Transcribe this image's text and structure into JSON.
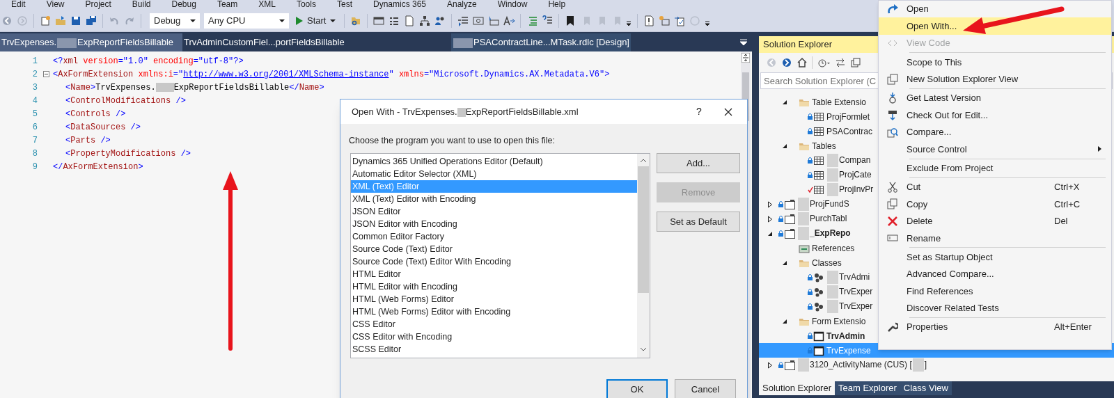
{
  "menu_bar": [
    "Edit",
    "View",
    "Project",
    "Build",
    "Debug",
    "Team",
    "XML",
    "Tools",
    "Test",
    "Dynamics 365",
    "Analyze",
    "Window",
    "Help"
  ],
  "toolbar": {
    "configuration": "Debug",
    "platform": "Any CPU",
    "start": "Start"
  },
  "doc_tabs": [
    {
      "parts": [
        {
          "kind": "text",
          "text": "TrvExpenses."
        },
        {
          "kind": "redaction"
        },
        {
          "kind": "text",
          "text": "ExpReportFieldsBillable"
        }
      ],
      "selected": true
    },
    {
      "parts": [
        {
          "kind": "text",
          "text": "TrvAdminCustomFiel...portFieldsBillable"
        }
      ],
      "selected": false
    },
    {
      "parts": [
        {
          "kind": "redaction"
        },
        {
          "kind": "text",
          "text": "PSAContractLine...MTask.rdlc [Design]"
        }
      ],
      "selected": false
    }
  ],
  "code": [
    {
      "number": "1",
      "tokens": [
        {
          "kind": "delimiter",
          "text": "<?"
        },
        {
          "kind": "element",
          "text": "xml"
        },
        {
          "kind": "attribute",
          "text": " version"
        },
        {
          "kind": "delimiter",
          "text": "=\"1.0\""
        },
        {
          "kind": "attribute",
          "text": " encoding"
        },
        {
          "kind": "delimiter",
          "text": "=\"utf-8\"?>"
        }
      ]
    },
    {
      "number": "2",
      "expanded": true,
      "tokens": [
        {
          "kind": "delimiter",
          "text": "<"
        },
        {
          "kind": "element",
          "text": "AxFormExtension"
        },
        {
          "kind": "attribute",
          "text": " xmlns:i"
        },
        {
          "kind": "delimiter",
          "text": "=\""
        },
        {
          "kind": "link",
          "text": "http://www.w3.org/2001/XMLSchema-instance"
        },
        {
          "kind": "delimiter",
          "text": "\""
        },
        {
          "kind": "attribute",
          "text": " xmlns"
        },
        {
          "kind": "delimiter",
          "text": "=\"Microsoft.Dynamics.AX.Metadata.V6\">"
        }
      ],
      "children": [
        {
          "number": "3",
          "tokens": [
            {
              "kind": "delimiter",
              "text": "<"
            },
            {
              "kind": "element",
              "text": "Name"
            },
            {
              "kind": "delimiter",
              "text": ">"
            },
            {
              "kind": "content",
              "text": "TrvExpenses."
            },
            {
              "kind": "redaction"
            },
            {
              "kind": "content",
              "text": "ExpReportFieldsBillable"
            },
            {
              "kind": "delimiter",
              "text": "</"
            },
            {
              "kind": "element",
              "text": "Name"
            },
            {
              "kind": "delimiter",
              "text": ">"
            }
          ]
        },
        {
          "number": "4",
          "tokens": [
            {
              "kind": "delimiter",
              "text": "<"
            },
            {
              "kind": "element",
              "text": "ControlModifications"
            },
            {
              "kind": "delimiter",
              "text": " />"
            }
          ]
        },
        {
          "number": "5",
          "tokens": [
            {
              "kind": "delimiter",
              "text": "<"
            },
            {
              "kind": "element",
              "text": "Controls"
            },
            {
              "kind": "delimiter",
              "text": " />"
            }
          ]
        },
        {
          "number": "6",
          "tokens": [
            {
              "kind": "delimiter",
              "text": "<"
            },
            {
              "kind": "element",
              "text": "DataSources"
            },
            {
              "kind": "delimiter",
              "text": " />"
            }
          ]
        },
        {
          "number": "7",
          "tokens": [
            {
              "kind": "delimiter",
              "text": "<"
            },
            {
              "kind": "element",
              "text": "Parts"
            },
            {
              "kind": "delimiter",
              "text": " />"
            }
          ]
        },
        {
          "number": "8",
          "tokens": [
            {
              "kind": "delimiter",
              "text": "<"
            },
            {
              "kind": "element",
              "text": "PropertyModifications"
            },
            {
              "kind": "delimiter",
              "text": " />"
            }
          ]
        }
      ]
    },
    {
      "number": "9",
      "tokens": [
        {
          "kind": "delimiter",
          "text": "</"
        },
        {
          "kind": "element",
          "text": "AxFormExtension"
        },
        {
          "kind": "delimiter",
          "text": ">"
        }
      ]
    }
  ],
  "dialog": {
    "title_parts": [
      {
        "kind": "text",
        "text": "Open With - TrvExpenses."
      },
      {
        "kind": "redaction"
      },
      {
        "kind": "text",
        "text": "ExpReportFieldsBillable.xml"
      }
    ],
    "help": "?",
    "prompt": "Choose the program you want to use to open this file:",
    "programs": [
      {
        "label": "Dynamics 365 Unified Operations Editor (Default)",
        "selected": false
      },
      {
        "label": "Automatic Editor Selector (XML)",
        "selected": false
      },
      {
        "label": "XML (Text) Editor",
        "selected": true
      },
      {
        "label": "XML (Text) Editor with Encoding",
        "selected": false
      },
      {
        "label": "JSON Editor",
        "selected": false
      },
      {
        "label": "JSON Editor with Encoding",
        "selected": false
      },
      {
        "label": "Common Editor Factory",
        "selected": false
      },
      {
        "label": "Source Code (Text) Editor",
        "selected": false
      },
      {
        "label": "Source Code (Text) Editor With Encoding",
        "selected": false
      },
      {
        "label": "HTML Editor",
        "selected": false
      },
      {
        "label": "HTML Editor with Encoding",
        "selected": false
      },
      {
        "label": "HTML (Web Forms) Editor",
        "selected": false
      },
      {
        "label": "HTML (Web Forms) Editor with Encoding",
        "selected": false
      },
      {
        "label": "CSS Editor",
        "selected": false
      },
      {
        "label": "CSS Editor with Encoding",
        "selected": false
      },
      {
        "label": "SCSS Editor",
        "selected": false
      }
    ],
    "side_buttons": [
      {
        "label": "Add...",
        "disabled": false
      },
      {
        "label": "Remove",
        "disabled": true
      },
      {
        "label": "Set as Default",
        "disabled": false
      }
    ],
    "footer_buttons": [
      {
        "label": "OK",
        "default": true
      },
      {
        "label": "Cancel",
        "default": false
      }
    ]
  },
  "solution_explorer": {
    "title": "Solution Explorer",
    "search_placeholder": "Search Solution Explorer (C",
    "tree": [
      {
        "children": [
          {
            "kind": "folder",
            "expanded": true,
            "selected": false,
            "parts": [
              {
                "kind": "text",
                "text": "Table Extensio"
              }
            ],
            "children": [
              {
                "kind": "table",
                "locked": true,
                "selected": false,
                "parts": [
                  {
                    "kind": "text",
                    "text": "ProjFormlet"
                  }
                ]
              },
              {
                "kind": "table",
                "locked": true,
                "selected": false,
                "parts": [
                  {
                    "kind": "text",
                    "text": "PSAContrac"
                  }
                ]
              }
            ]
          },
          {
            "kind": "folder",
            "expanded": true,
            "selected": false,
            "parts": [
              {
                "kind": "text",
                "text": "Tables"
              }
            ],
            "children": [
              {
                "kind": "table",
                "locked": true,
                "selected": false,
                "parts": [
                  {
                    "kind": "redaction"
                  },
                  {
                    "kind": "text",
                    "text": "Compan"
                  }
                ]
              },
              {
                "kind": "table",
                "locked": true,
                "selected": false,
                "parts": [
                  {
                    "kind": "redaction"
                  },
                  {
                    "kind": "text",
                    "text": "ProjCate"
                  }
                ]
              },
              {
                "kind": "table",
                "checked_out": true,
                "selected": false,
                "parts": [
                  {
                    "kind": "redaction"
                  },
                  {
                    "kind": "text",
                    "text": "ProjInvPr"
                  }
                ]
              }
            ]
          }
        ]
      },
      {
        "kind": "project",
        "locked": true,
        "expanded": false,
        "selected": false,
        "parts": [
          {
            "kind": "redaction"
          },
          {
            "kind": "text",
            "text": "ProjFundS"
          }
        ]
      },
      {
        "kind": "project",
        "locked": true,
        "expanded": false,
        "selected": false,
        "parts": [
          {
            "kind": "redaction"
          },
          {
            "kind": "text",
            "text": "PurchTabl"
          }
        ]
      },
      {
        "kind": "project",
        "locked": true,
        "expanded": true,
        "bold": true,
        "selected": false,
        "parts": [
          {
            "kind": "redaction"
          },
          {
            "kind": "text",
            "text": "_ExpRepo"
          }
        ],
        "children": [
          {
            "kind": "references",
            "selected": false,
            "parts": [
              {
                "kind": "text",
                "text": "References"
              }
            ]
          },
          {
            "kind": "folder",
            "expanded": true,
            "selected": false,
            "parts": [
              {
                "kind": "text",
                "text": "Classes"
              }
            ],
            "children": [
              {
                "kind": "class",
                "locked": true,
                "selected": false,
                "parts": [
                  {
                    "kind": "redaction"
                  },
                  {
                    "kind": "text",
                    "text": "TrvAdmi"
                  }
                ]
              },
              {
                "kind": "class",
                "locked": true,
                "selected": false,
                "parts": [
                  {
                    "kind": "redaction"
                  },
                  {
                    "kind": "text",
                    "text": "TrvExper"
                  }
                ]
              },
              {
                "kind": "class",
                "locked": true,
                "selected": false,
                "parts": [
                  {
                    "kind": "redaction"
                  },
                  {
                    "kind": "text",
                    "text": "TrvExper"
                  }
                ]
              }
            ]
          },
          {
            "kind": "folder",
            "expanded": true,
            "selected": false,
            "parts": [
              {
                "kind": "text",
                "text": "Form Extensio"
              }
            ],
            "children": [
              {
                "kind": "form",
                "locked": true,
                "bold": true,
                "selected": false,
                "parts": [
                  {
                    "kind": "text",
                    "text": "TrvAdmin"
                  }
                ]
              },
              {
                "kind": "form",
                "locked": true,
                "selected": true,
                "parts": [
                  {
                    "kind": "text",
                    "text": "TrvExpense"
                  }
                ]
              }
            ]
          }
        ]
      },
      {
        "kind": "project",
        "locked": true,
        "expanded": false,
        "selected": false,
        "parts": [
          {
            "kind": "redaction"
          },
          {
            "kind": "text",
            "text": "3120_ActivityName (CUS) ["
          },
          {
            "kind": "redaction"
          },
          {
            "kind": "text",
            "text": "]"
          }
        ]
      }
    ],
    "bottom_tabs": [
      {
        "label": "Solution Explorer",
        "selected": true
      },
      {
        "label": "Team Explorer",
        "selected": false
      },
      {
        "label": "Class View",
        "selected": false
      }
    ]
  },
  "context_menu": [
    {
      "kind": "redo",
      "label": "Open",
      "disabled": false,
      "selected": false
    },
    {
      "kind": "item",
      "label": "Open With...",
      "disabled": false,
      "selected": true
    },
    {
      "kind": "code",
      "label": "View Code",
      "disabled": true,
      "selected": false
    },
    {
      "kind": "separator"
    },
    {
      "kind": "item",
      "label": "Scope to This",
      "disabled": false,
      "selected": false
    },
    {
      "kind": "windows",
      "label": "New Solution Explorer View",
      "disabled": false,
      "selected": false
    },
    {
      "kind": "separator"
    },
    {
      "kind": "download",
      "label": "Get Latest Version",
      "disabled": false,
      "selected": false
    },
    {
      "kind": "checkout",
      "label": "Check Out for Edit...",
      "disabled": false,
      "selected": false
    },
    {
      "kind": "compare",
      "label": "Compare...",
      "disabled": false,
      "selected": false
    },
    {
      "kind": "item",
      "label": "Source Control",
      "submenu": true,
      "disabled": false,
      "selected": false
    },
    {
      "kind": "separator"
    },
    {
      "kind": "item",
      "label": "Exclude From Project",
      "disabled": false,
      "selected": false
    },
    {
      "kind": "separator"
    },
    {
      "kind": "cut",
      "label": "Cut",
      "shortcut": "Ctrl+X",
      "disabled": false,
      "selected": false
    },
    {
      "kind": "copy",
      "label": "Copy",
      "shortcut": "Ctrl+C",
      "disabled": false,
      "selected": false
    },
    {
      "kind": "delete",
      "label": "Delete",
      "shortcut": "Del",
      "disabled": false,
      "selected": false
    },
    {
      "kind": "rename",
      "label": "Rename",
      "disabled": false,
      "selected": false
    },
    {
      "kind": "separator"
    },
    {
      "kind": "item",
      "label": "Set as Startup Object",
      "disabled": false,
      "selected": false
    },
    {
      "kind": "item",
      "label": "Advanced Compare...",
      "disabled": false,
      "selected": false
    },
    {
      "kind": "item",
      "label": "Find References",
      "disabled": false,
      "selected": false
    },
    {
      "kind": "item",
      "label": "Discover Related Tests",
      "disabled": false,
      "selected": false
    },
    {
      "kind": "separator"
    },
    {
      "kind": "wrench",
      "label": "Properties",
      "shortcut": "Alt+Enter",
      "disabled": false,
      "selected": false
    }
  ]
}
